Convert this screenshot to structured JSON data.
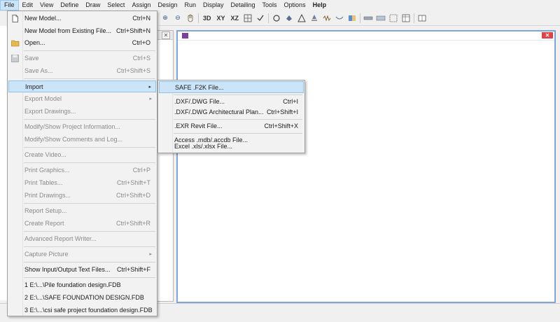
{
  "menubar": [
    "File",
    "Edit",
    "View",
    "Define",
    "Draw",
    "Select",
    "Assign",
    "Design",
    "Run",
    "Display",
    "Detailing",
    "Tools",
    "Options",
    "Help"
  ],
  "toolbar": {
    "zoom_in_glyph": "⊕",
    "zoom_out_glyph": "⊖",
    "view_3d": "3D",
    "view_xy": "XY",
    "view_xz": "XZ"
  },
  "file_menu": {
    "new_model": {
      "label": "New Model...",
      "shortcut": "Ctrl+N"
    },
    "new_from_existing": {
      "label": "New Model from Existing File...",
      "shortcut": "Ctrl+Shift+N"
    },
    "open": {
      "label": "Open...",
      "shortcut": "Ctrl+O"
    },
    "save": {
      "label": "Save",
      "shortcut": "Ctrl+S"
    },
    "save_as": {
      "label": "Save As...",
      "shortcut": "Ctrl+Shift+S"
    },
    "import": {
      "label": "Import",
      "arrow": "▸"
    },
    "export_model": {
      "label": "Export Model",
      "arrow": "▸"
    },
    "export_drawings": {
      "label": "Export Drawings..."
    },
    "modify_project_info": {
      "label": "Modify/Show Project Information..."
    },
    "modify_comments": {
      "label": "Modify/Show Comments and Log..."
    },
    "create_video": {
      "label": "Create Video..."
    },
    "print_graphics": {
      "label": "Print Graphics...",
      "shortcut": "Ctrl+P"
    },
    "print_tables": {
      "label": "Print Tables...",
      "shortcut": "Ctrl+Shift+T"
    },
    "print_drawings": {
      "label": "Print Drawings...",
      "shortcut": "Ctrl+Shift+D"
    },
    "report_setup": {
      "label": "Report Setup..."
    },
    "create_report": {
      "label": "Create Report",
      "shortcut": "Ctrl+Shift+R"
    },
    "advanced_report_writer": {
      "label": "Advanced Report Writer..."
    },
    "capture_picture": {
      "label": "Capture Picture",
      "arrow": "▸"
    },
    "show_io_text": {
      "label": "Show Input/Output Text Files...",
      "shortcut": "Ctrl+Shift+F"
    },
    "recent1": {
      "label": "1 E:\\...\\Pile foundation design.FDB"
    },
    "recent2": {
      "label": "2 E:\\...\\SAFE FOUNDATION DESIGN.FDB"
    },
    "recent3": {
      "label": "3 E:\\...\\csi safe project foundation design.FDB"
    }
  },
  "import_submenu": {
    "safe_f2k": {
      "label": "SAFE .F2K File..."
    },
    "dxf_dwg": {
      "label": ".DXF/.DWG File...",
      "shortcut": "Ctrl+I"
    },
    "dxf_dwg_arch": {
      "label": ".DXF/.DWG Architectural Plan...",
      "shortcut": "Ctrl+Shift+I"
    },
    "exr_revit": {
      "label": ".EXR Revit File...",
      "shortcut": "Ctrl+Shift+X"
    },
    "access": {
      "label": "Access .mdb/.accdb File..."
    },
    "excel": {
      "label": "Excel .xls/.xlsx File..."
    }
  },
  "panel": {
    "close_glyph": "✕"
  },
  "window": {
    "close_glyph": "✕"
  },
  "colors": {
    "highlight": "#cce4f7",
    "window_border": "#7fa6d6",
    "close_red": "#e04343"
  }
}
